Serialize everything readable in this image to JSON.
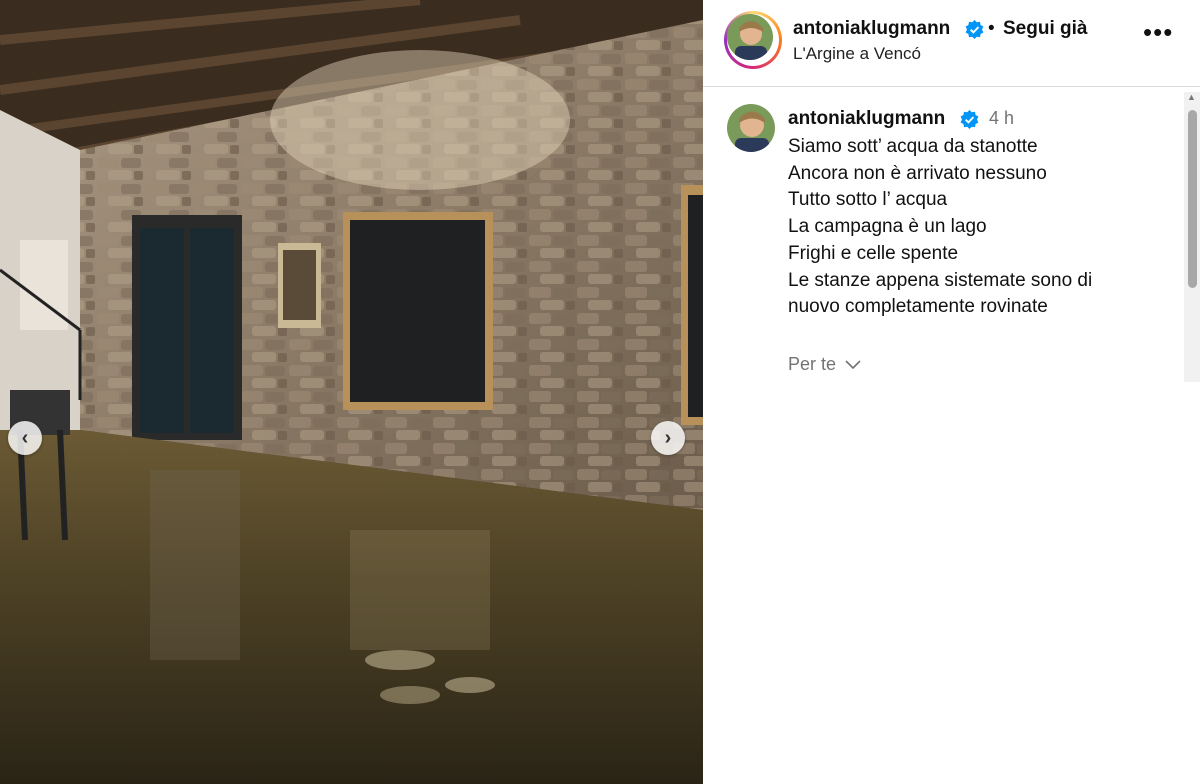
{
  "post": {
    "username": "antoniaklugmann",
    "follow_label": "Segui già",
    "separator": "•",
    "location": "L'Argine a Vencó",
    "more_icon": "more-options-icon",
    "prev_icon": "chevron-left-icon",
    "next_icon": "chevron-right-icon"
  },
  "comment": {
    "username": "antoniaklugmann",
    "time": "4 h",
    "caption_lines": [
      "Siamo sott’ acqua da stanotte",
      "Ancora non è arrivato nessuno",
      "Tutto sotto l’ acqua",
      "La campagna è un lago",
      "Frighi e celle spente",
      "Le stanze appena sistemate sono di",
      "nuovo completamente rovinate"
    ],
    "per_te": "Per te"
  },
  "colors": {
    "verified": "#0095f6",
    "muted_text": "#737373"
  }
}
